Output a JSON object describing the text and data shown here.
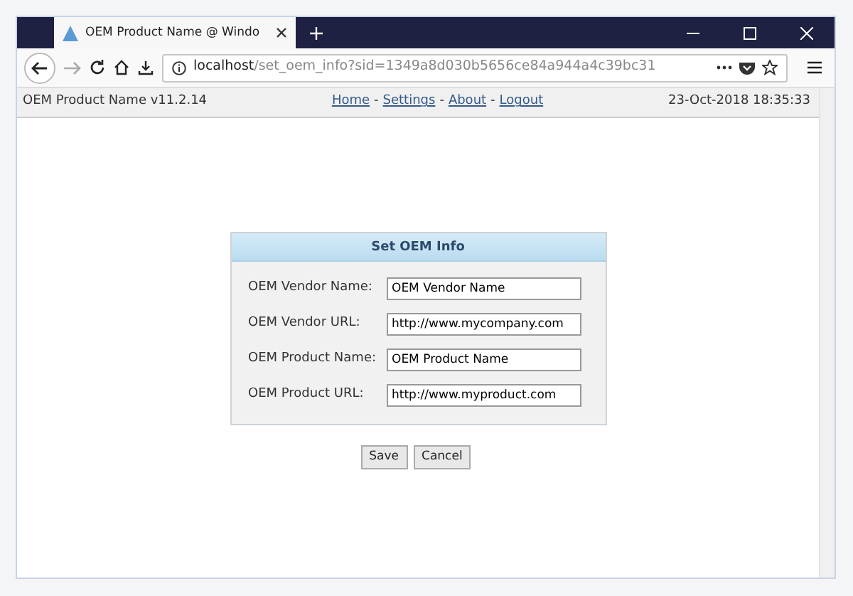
{
  "browser": {
    "tab_title": "OEM Product Name @ Windo",
    "url_host": "localhost",
    "url_path": "/set_oem_info?sid=1349a8d030b5656ce84a944a4c39bc31"
  },
  "header": {
    "product": "OEM Product Name v11.2.14",
    "nav": [
      {
        "label": "Home"
      },
      {
        "label": "Settings"
      },
      {
        "label": "About"
      },
      {
        "label": "Logout"
      }
    ],
    "separator": "-",
    "datetime": "23-Oct-2018 18:35:33"
  },
  "form": {
    "title": "Set OEM Info",
    "fields": [
      {
        "label": "OEM Vendor Name:",
        "value": "OEM Vendor Name"
      },
      {
        "label": "OEM Vendor URL:",
        "value": "http://www.mycompany.com"
      },
      {
        "label": "OEM Product Name:",
        "value": "OEM Product Name"
      },
      {
        "label": "OEM Product URL:",
        "value": "http://www.myproduct.com"
      }
    ]
  },
  "buttons": [
    {
      "label": "Save"
    },
    {
      "label": "Cancel"
    }
  ]
}
